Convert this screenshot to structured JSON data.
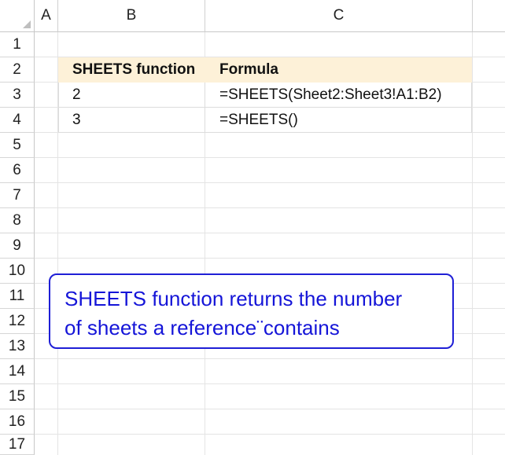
{
  "columns": [
    "A",
    "B",
    "C"
  ],
  "rows": [
    "1",
    "2",
    "3",
    "4",
    "5",
    "6",
    "7",
    "8",
    "9",
    "10",
    "11",
    "12",
    "13",
    "14",
    "15",
    "16",
    "17"
  ],
  "table": {
    "headers": [
      "SHEETS function",
      "Formula"
    ],
    "rows": [
      [
        "2",
        "=SHEETS(Sheet2:Sheet3!A1:B2)"
      ],
      [
        "3",
        "=SHEETS()"
      ]
    ]
  },
  "callout": {
    "line1": "SHEETS function returns the number",
    "line2": "of sheets a reference¨contains"
  },
  "colors": {
    "header_fill": "#fdf1d8",
    "callout_border": "#1f1fd6",
    "callout_text": "#1515d8"
  }
}
